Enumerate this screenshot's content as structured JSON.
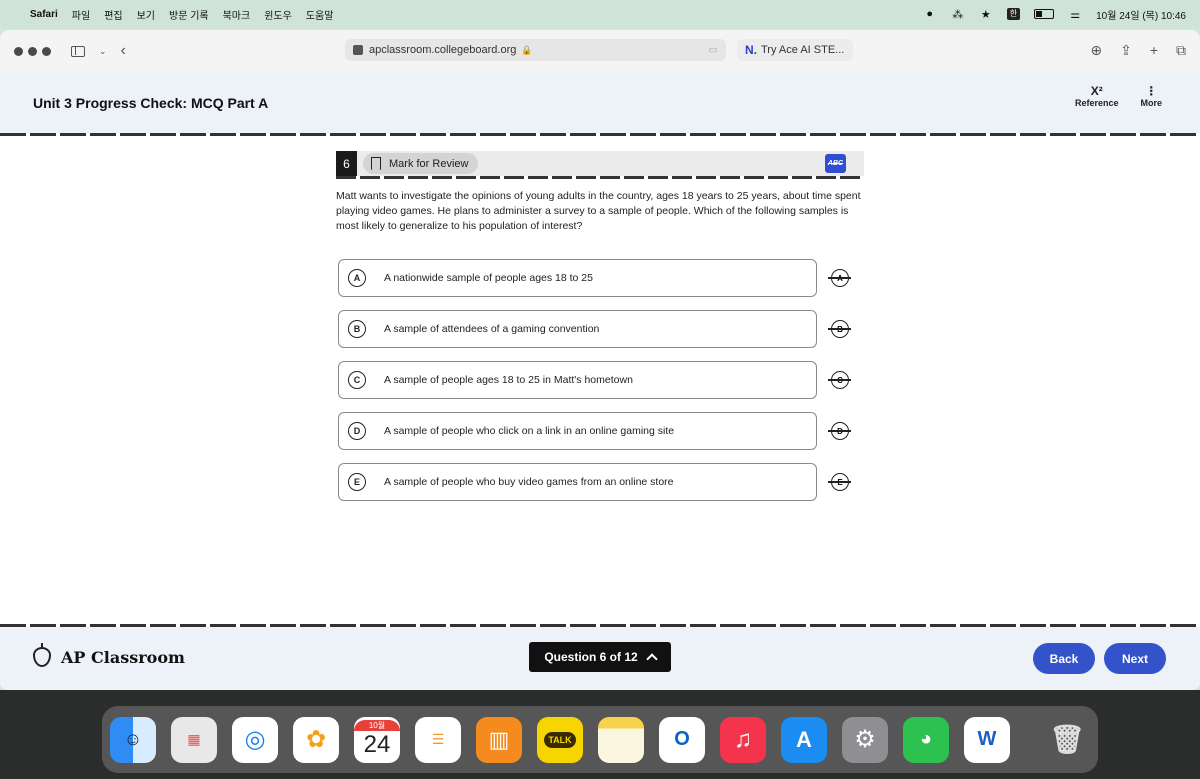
{
  "menubar": {
    "app": "Safari",
    "items": [
      "파일",
      "편집",
      "보기",
      "방문 기록",
      "북마크",
      "윈도우",
      "도움말"
    ],
    "input_badge": "한",
    "datetime": "10월 24일 (목) 10:46"
  },
  "browser": {
    "url": "apclassroom.collegeboard.org",
    "second_tab": "Try Ace AI STE..."
  },
  "header": {
    "title": "Unit 3 Progress Check: MCQ Part A",
    "reference_label": "Reference",
    "more_label": "More"
  },
  "question": {
    "number": "6",
    "mark_review_label": "Mark for Review",
    "stem": "Matt wants to investigate the opinions of young adults in the country, ages 18 years to 25 years, about time spent playing video games. He plans to administer a survey to a sample of people. Which of the following samples is most likely to generalize to his population of interest?",
    "choices": [
      {
        "letter": "A",
        "text": "A nationwide sample of people ages 18 to 25"
      },
      {
        "letter": "B",
        "text": "A sample of attendees of a gaming convention"
      },
      {
        "letter": "C",
        "text": "A sample of people ages 18 to 25 in Matt's hometown"
      },
      {
        "letter": "D",
        "text": "A sample of people who click on a link in an online gaming site"
      },
      {
        "letter": "E",
        "text": "A sample of people who buy video games from an online store"
      }
    ]
  },
  "footer": {
    "brand": "AP Classroom",
    "question_nav": "Question 6 of 12",
    "back_label": "Back",
    "next_label": "Next"
  },
  "dock": {
    "calendar_month": "10월",
    "calendar_day": "24",
    "talk_label": "TALK"
  },
  "colors": {
    "accent": "#3453cb",
    "header_bg": "#edf1f8"
  }
}
